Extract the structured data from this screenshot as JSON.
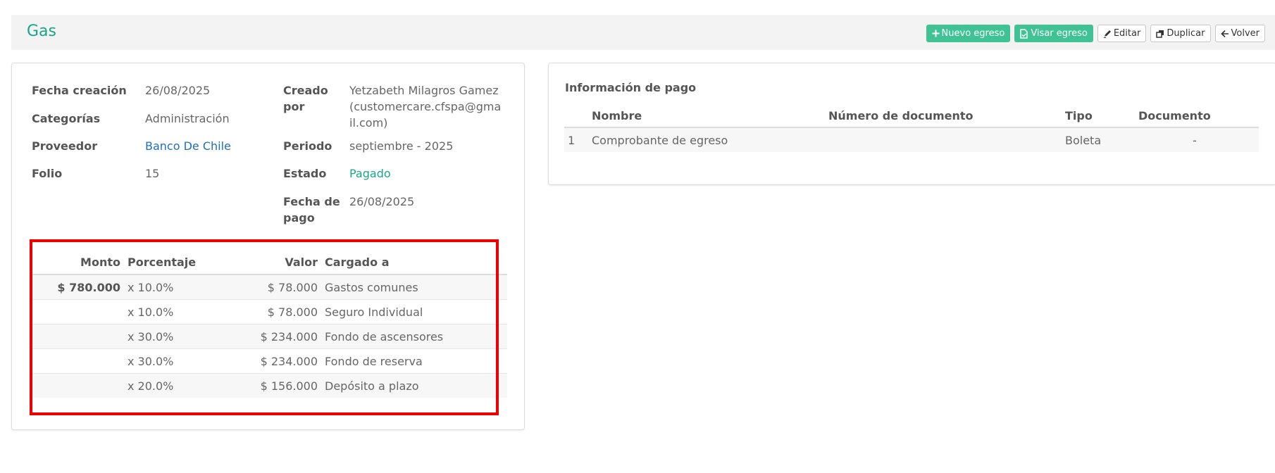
{
  "header": {
    "title": "Gas",
    "buttons": {
      "new_expense": "Nuevo egreso",
      "approve_expense": "Visar egreso",
      "edit": "Editar",
      "duplicate": "Duplicar",
      "back": "Volver"
    }
  },
  "details": {
    "fecha_creacion": {
      "label": "Fecha creación",
      "value": "26/08/2025"
    },
    "categorias": {
      "label": "Categorías",
      "value": "Administración"
    },
    "proveedor": {
      "label": "Proveedor",
      "value": "Banco De Chile"
    },
    "folio": {
      "label": "Folio",
      "value": "15"
    },
    "creado_por": {
      "label_line1": "Creado",
      "label_line2": "por",
      "value_line1": "Yetzabeth Milagros Gamez",
      "value_line2": "(customercare.cfspa@gma",
      "value_line3": "il.com)"
    },
    "periodo": {
      "label": "Periodo",
      "value": "septiembre - 2025"
    },
    "estado": {
      "label": "Estado",
      "value": "Pagado"
    },
    "fecha_pago": {
      "label_line1": "Fecha de",
      "label_line2": "pago",
      "value": "26/08/2025"
    }
  },
  "distribution": {
    "headers": {
      "monto": "Monto",
      "porcentaje": "Porcentaje",
      "valor": "Valor",
      "cargado": "Cargado a"
    },
    "rows": [
      {
        "monto": "$ 780.000",
        "porcentaje": "x 10.0%",
        "valor": "$ 78.000",
        "cargado": "Gastos comunes"
      },
      {
        "monto": "",
        "porcentaje": "x 10.0%",
        "valor": "$ 78.000",
        "cargado": "Seguro Individual"
      },
      {
        "monto": "",
        "porcentaje": "x 30.0%",
        "valor": "$ 234.000",
        "cargado": "Fondo de ascensores"
      },
      {
        "monto": "",
        "porcentaje": "x 30.0%",
        "valor": "$ 234.000",
        "cargado": "Fondo de reserva"
      },
      {
        "monto": "",
        "porcentaje": "x 20.0%",
        "valor": "$ 156.000",
        "cargado": "Depósito a plazo"
      }
    ]
  },
  "payment": {
    "title": "Información de pago",
    "headers": {
      "nombre": "Nombre",
      "numero": "Número de documento",
      "tipo": "Tipo",
      "documento": "Documento"
    },
    "rows": [
      {
        "index": "1",
        "nombre": "Comprobante de egreso",
        "numero": "",
        "tipo": "Boleta",
        "documento": "-"
      }
    ]
  },
  "colors": {
    "accent": "#17a589",
    "button_green": "#3fc395",
    "link": "#1f6fb8",
    "highlight": "#ee0000"
  },
  "icons": {
    "new_expense": "plus-icon",
    "approve_expense": "file-check-icon",
    "edit": "pencil-icon",
    "duplicate": "copy-icon",
    "back": "arrow-left-icon"
  }
}
